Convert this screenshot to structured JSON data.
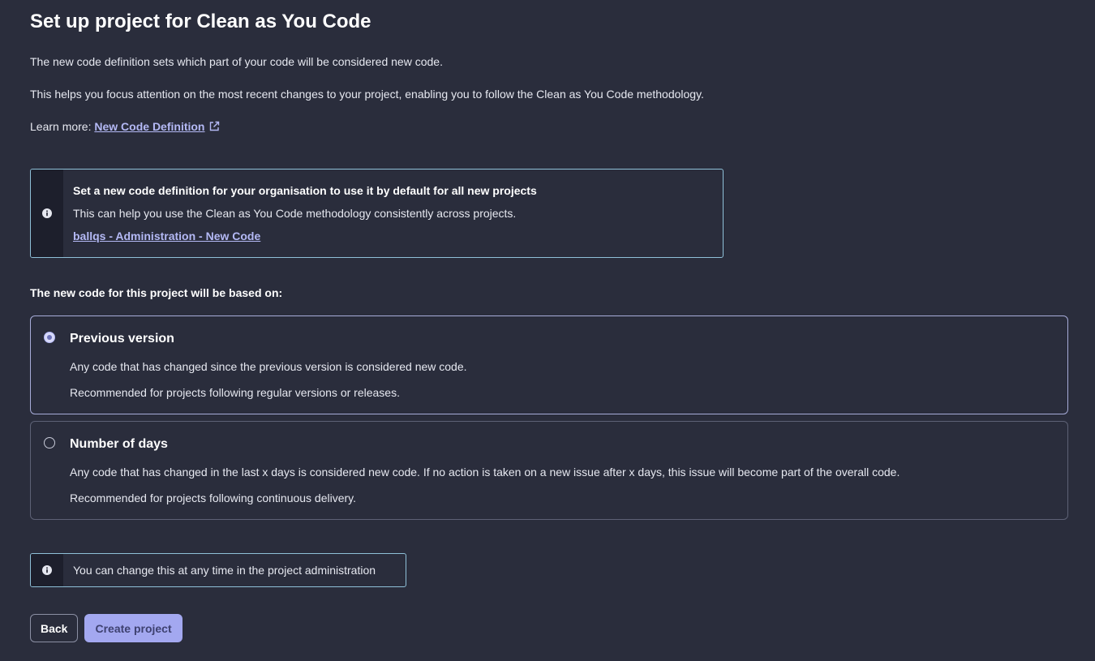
{
  "header": {
    "title": "Set up project for Clean as You Code"
  },
  "intro": {
    "line1": "The new code definition sets which part of your code will be considered new code.",
    "line2": "This helps you focus attention on the most recent changes to your project, enabling you to follow the Clean as You Code methodology.",
    "learn_more_prefix": "Learn more: ",
    "learn_more_link": "New Code Definition"
  },
  "org_notice": {
    "title": "Set a new code definition for your organisation to use it by default for all new projects",
    "text": "This can help you use the Clean as You Code methodology consistently across projects.",
    "link": "ballqs - Administration - New Code"
  },
  "options_heading": "The new code for this project will be based on:",
  "options": [
    {
      "title": "Previous version",
      "description": "Any code that has changed since the previous version is considered new code.",
      "recommendation": "Recommended for projects following regular versions or releases.",
      "selected": true
    },
    {
      "title": "Number of days",
      "description": "Any code that has changed in the last x days is considered new code. If no action is taken on a new issue after x days, this issue will become part of the overall code.",
      "recommendation": "Recommended for projects following continuous delivery.",
      "selected": false
    }
  ],
  "change_notice": {
    "text": "You can change this at any time in the project administration"
  },
  "buttons": {
    "back": "Back",
    "create": "Create project"
  },
  "icons": {
    "info": "info-icon",
    "external": "external-link-icon"
  },
  "colors": {
    "background": "#2a2d3c",
    "accent": "#a3a8f0",
    "link": "#b4b9f5",
    "info_border": "#8fc0d8"
  }
}
